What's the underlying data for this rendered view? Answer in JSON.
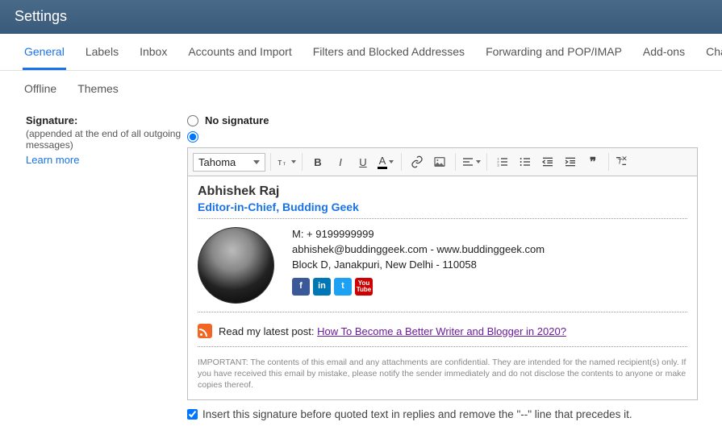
{
  "header": {
    "title": "Settings"
  },
  "tabs": {
    "row1": [
      "General",
      "Labels",
      "Inbox",
      "Accounts and Import",
      "Filters and Blocked Addresses",
      "Forwarding and POP/IMAP",
      "Add-ons",
      "Chat"
    ],
    "row2": [
      "Offline",
      "Themes"
    ],
    "active": "General"
  },
  "signature": {
    "section_title": "Signature:",
    "section_desc": "(appended at the end of all outgoing messages)",
    "learn_more": "Learn more",
    "no_signature_label": "No signature",
    "font_name": "Tahoma",
    "name": "Abhishek Raj",
    "title": "Editor-in-Chief, Budding Geek",
    "phone": "M: + 9199999999",
    "email_web": "abhishek@buddinggeek.com - www.buddinggeek.com",
    "address": "Block D, Janakpuri, New Delhi - 110058",
    "socials": {
      "fb": "f",
      "li": "in",
      "tw": "t",
      "yt": "You\nTube"
    },
    "latest_label": "Read my latest post: ",
    "latest_link": "How To Become a Better Writer and Blogger in 2020?",
    "disclaimer": "IMPORTANT: The contents of this email and any attachments are confidential. They are intended for the named recipient(s) only. If you have received this email by mistake, please notify the sender immediately and do not disclose the contents to anyone or make copies thereof.",
    "checkbox_label": "Insert this signature before quoted text in replies and remove the \"--\" line that precedes it."
  }
}
